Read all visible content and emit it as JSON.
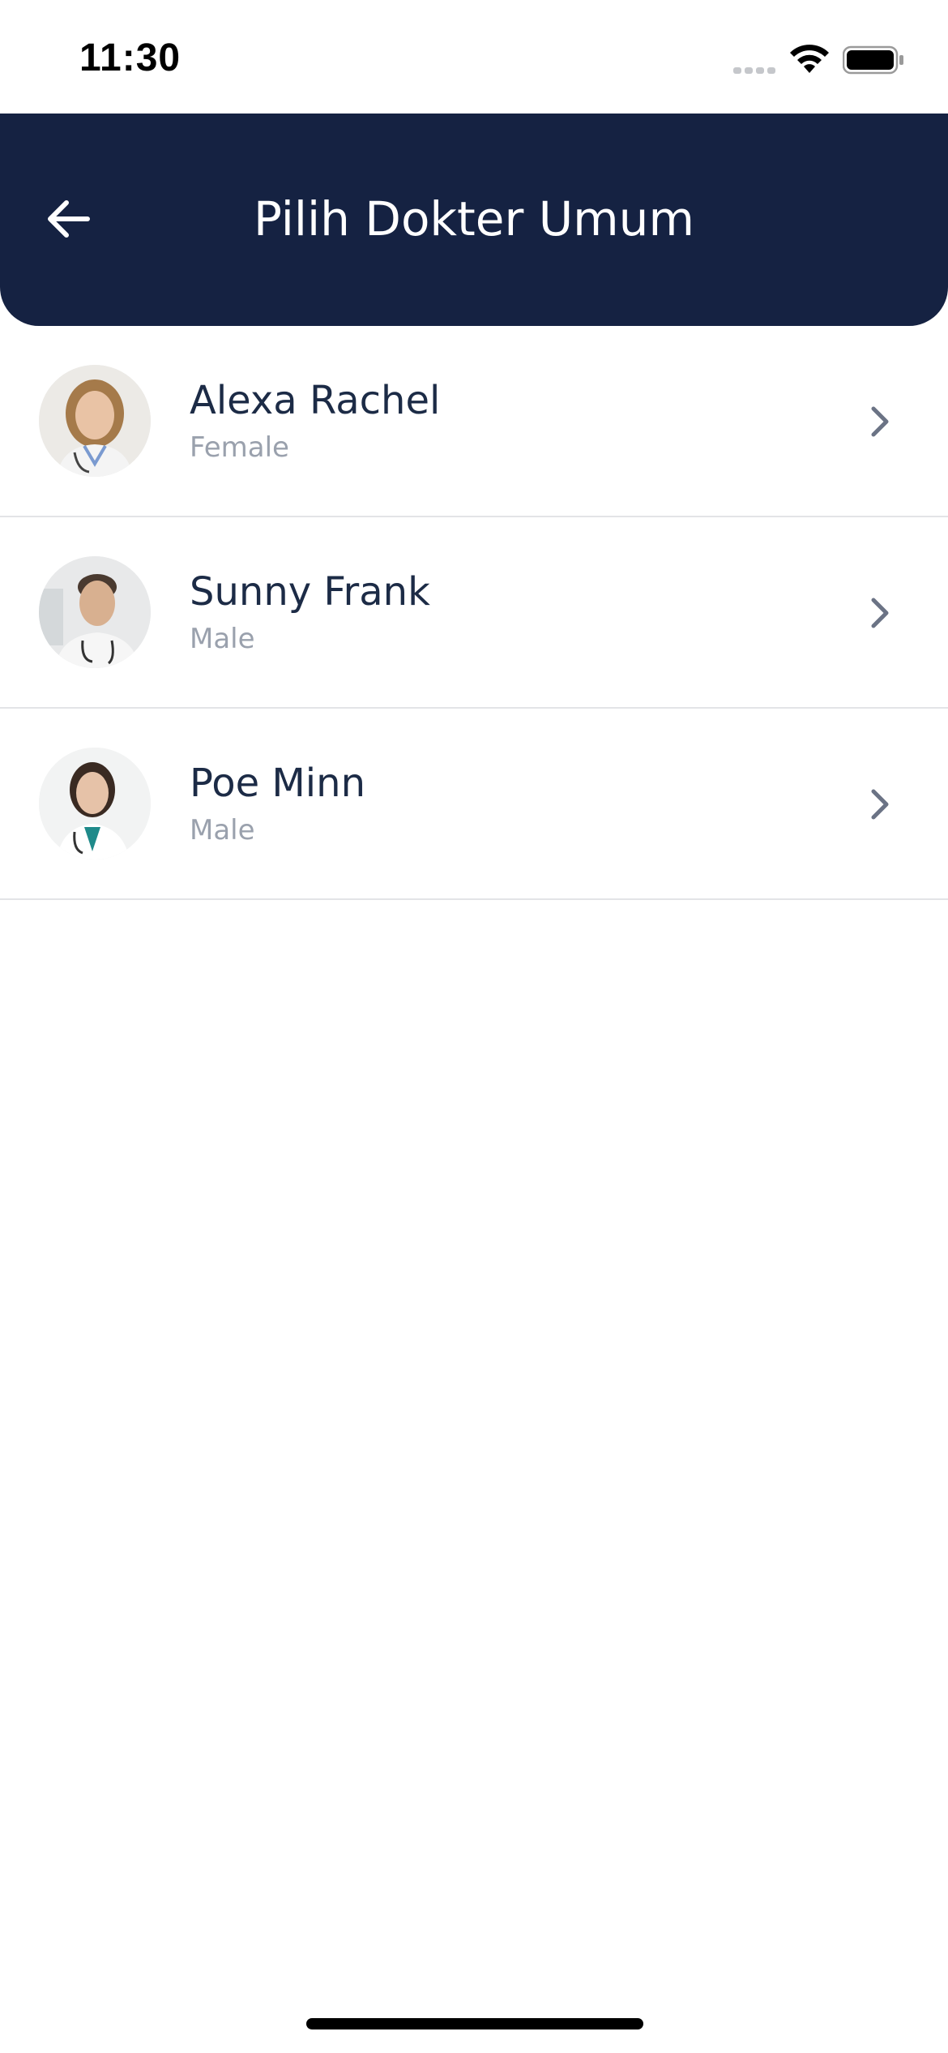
{
  "status_bar": {
    "time": "11:30",
    "icons": [
      "signal-icon",
      "wifi-icon",
      "battery-icon"
    ]
  },
  "header": {
    "title": "Pilih Dokter Umum",
    "back_icon": "arrow-left-icon",
    "background_color": "#152242"
  },
  "doctors": [
    {
      "name": "Alexa Rachel",
      "gender": "Female"
    },
    {
      "name": "Sunny Frank",
      "gender": "Male"
    },
    {
      "name": "Poe Minn",
      "gender": "Male"
    }
  ],
  "colors": {
    "name_text": "#1c2b46",
    "secondary_text": "#9aa1ad",
    "chevron": "#6b7385",
    "divider": "#e3e4e7"
  }
}
